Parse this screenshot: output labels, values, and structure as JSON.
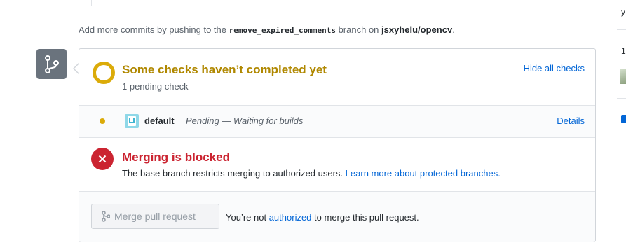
{
  "hint": {
    "prefix": "Add more commits by pushing to the",
    "branch": "remove_expired_comments",
    "middle": "branch on",
    "repo": "jsxyhelu/opencv",
    "suffix": "."
  },
  "badge_icon": "git-branch-icon",
  "checks": {
    "title": "Some checks haven’t completed yet",
    "subtitle": "1 pending check",
    "toggle_label": "Hide all checks",
    "items": [
      {
        "name": "default",
        "description": "Pending — Waiting for builds",
        "link_label": "Details",
        "status": "pending"
      }
    ]
  },
  "merge": {
    "title": "Merging is blocked",
    "description": "The base branch restricts merging to authorized users.",
    "learn_more": "Learn more about protected branches.",
    "button_label": "Merge pull request",
    "note_prefix": "You’re not",
    "note_link": "authorized",
    "note_suffix": "to merge this pull request."
  },
  "sidebar": {
    "fragment_top": "y",
    "fragment_count": "1"
  },
  "colors": {
    "pending": "#dbab09",
    "pending_text": "#b08800",
    "blocked": "#cb2431",
    "link": "#0366d6",
    "badge": "#6a737d"
  }
}
